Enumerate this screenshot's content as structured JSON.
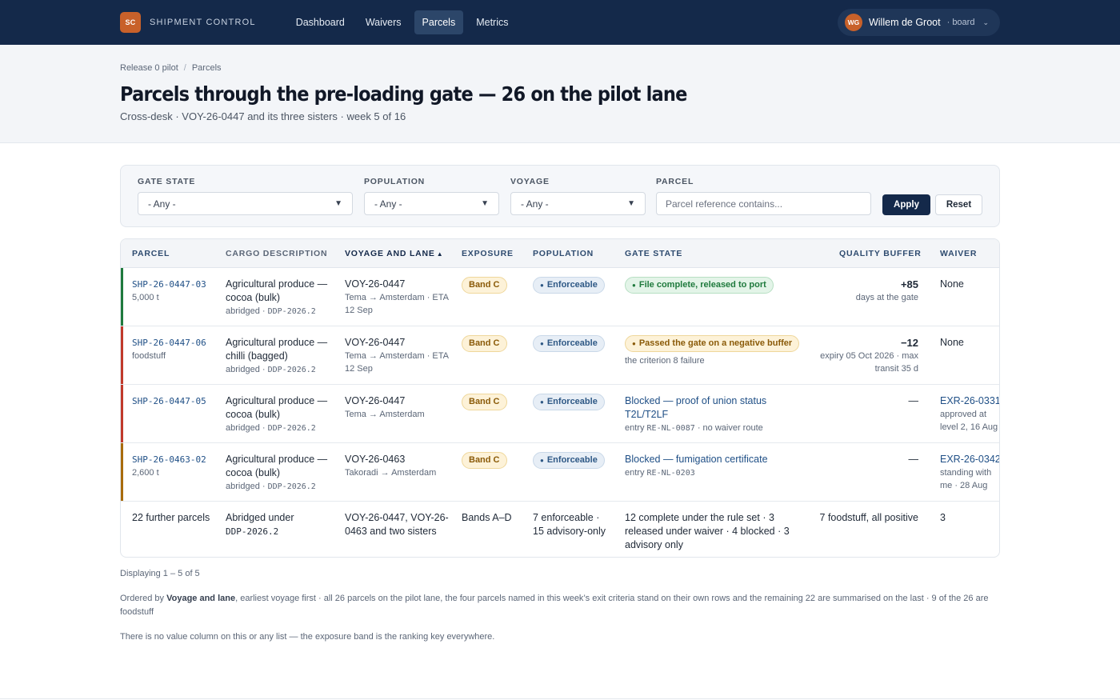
{
  "brand": {
    "logo": "SC",
    "name": "SHIPMENT CONTROL"
  },
  "nav": [
    {
      "label": "Dashboard",
      "active": false
    },
    {
      "label": "Waivers",
      "active": false
    },
    {
      "label": "Parcels",
      "active": true
    },
    {
      "label": "Metrics",
      "active": false
    }
  ],
  "user": {
    "initials": "WG",
    "name": "Willem de Groot",
    "role": "· board",
    "menu_icon": "chevron-down-icon"
  },
  "breadcrumb": [
    "Release 0 pilot",
    "Parcels"
  ],
  "page": {
    "title": "Parcels through the pre-loading gate — 26 on the pilot lane",
    "subtitle": "Cross-desk · VOY-26-0447 and its three sisters · week 5 of 16"
  },
  "filters": {
    "gate_state": {
      "label": "GATE STATE",
      "value": "- Any -"
    },
    "population": {
      "label": "POPULATION",
      "value": "- Any -"
    },
    "voyage": {
      "label": "VOYAGE",
      "value": "- Any -"
    },
    "parcel": {
      "label": "PARCEL",
      "placeholder": "Parcel reference contains..."
    },
    "apply": "Apply",
    "reset": "Reset"
  },
  "table": {
    "headers": {
      "parcel": "PARCEL",
      "cargo": "CARGO DESCRIPTION",
      "voyage": "VOYAGE AND LANE",
      "sort_indicator": "▲",
      "exposure": "EXPOSURE",
      "population": "POPULATION",
      "gate": "GATE STATE",
      "buffer": "QUALITY BUFFER",
      "waiver": "WAIVER"
    },
    "rows": [
      {
        "id": "SHP-26-0447-03",
        "qty": "5,000 t",
        "bar_color": "#1f7a3d",
        "cargo": "Agricultural produce — cocoa (bulk)",
        "cargo_sub": "abridged ·",
        "cargo_code": "DDP-2026.2",
        "voyage": "VOY-26-0447",
        "lane": "Tema → Amsterdam · ETA 12 Sep",
        "exposure": "Band C",
        "population": "Enforceable",
        "gate": "File complete, released to port",
        "gate_sub": "",
        "buffer": "+85",
        "buffer_sub": "days at the gate",
        "waiver": "None",
        "waiver_sub": ""
      },
      {
        "id": "SHP-26-0447-06",
        "qty": "foodstuff",
        "bar_color": "#c0392b",
        "cargo": "Agricultural produce — chilli (bagged)",
        "cargo_sub": "abridged ·",
        "cargo_code": "DDP-2026.2",
        "voyage": "VOY-26-0447",
        "lane": "Tema → Amsterdam · ETA 12 Sep",
        "exposure": "Band C",
        "population": "Enforceable",
        "gate": "Passed the gate on a negative buffer",
        "gate_sub": "the criterion 8 failure",
        "buffer": "−12",
        "buffer_sub": "expiry 05 Oct 2026 · max transit 35 d",
        "waiver": "None",
        "waiver_sub": ""
      },
      {
        "id": "SHP-26-0447-05",
        "qty": "",
        "bar_color": "#c0392b",
        "cargo": "Agricultural produce — cocoa (bulk)",
        "cargo_sub": "abridged ·",
        "cargo_code": "DDP-2026.2",
        "voyage": "VOY-26-0447",
        "lane": "Tema → Amsterdam",
        "exposure": "Band C",
        "population": "Enforceable",
        "gate": "Blocked — proof of union status T2L/T2LF",
        "gate_sub_pre": "entry",
        "gate_code": "RE-NL-0087",
        "gate_sub_post": "· no waiver route",
        "buffer": "—",
        "buffer_sub": "",
        "waiver": "EXR-26-0331",
        "waiver_sub": "approved at level 2, 16 Aug"
      },
      {
        "id": "SHP-26-0463-02",
        "qty": "2,600 t",
        "bar_color": "#a86b0c",
        "cargo": "Agricultural produce — cocoa (bulk)",
        "cargo_sub": "abridged ·",
        "cargo_code": "DDP-2026.2",
        "voyage": "VOY-26-0463",
        "lane": "Takoradi → Amsterdam",
        "exposure": "Band C",
        "population": "Enforceable",
        "gate": "Blocked — fumigation certificate",
        "gate_sub_pre": "entry",
        "gate_code": "RE-NL-0203",
        "gate_sub_post": "",
        "buffer": "—",
        "buffer_sub": "",
        "waiver": "EXR-26-0342",
        "waiver_sub": "standing with me · 28 Aug"
      }
    ],
    "summary": {
      "parcel": "22 further parcels",
      "cargo": "Abridged under",
      "cargo_code": "DDP-2026.2",
      "voyage": "VOY-26-0447, VOY-26-0463 and two sisters",
      "exposure": "Bands A–D",
      "population": "7 enforceable · 15 advisory-only",
      "gate": "12 complete under the rule set · 3 released under waiver · 4 blocked · 3 advisory only",
      "buffer": "7 foodstuff, all positive",
      "waiver": "3"
    }
  },
  "footer": {
    "count": "Displaying 1 – 5 of 5",
    "note_pre": "Ordered by",
    "note_bold": "Voyage and lane",
    "note_post": ", earliest voyage first · all 26 parcels on the pilot lane, the four parcels named in this week’s exit criteria stand on their own rows and the remaining 22 are summarised on the last · 9 of the 26 are foodstuff",
    "note2": "There is no value column on this or any list — the exposure band is the ranking key everywhere."
  }
}
